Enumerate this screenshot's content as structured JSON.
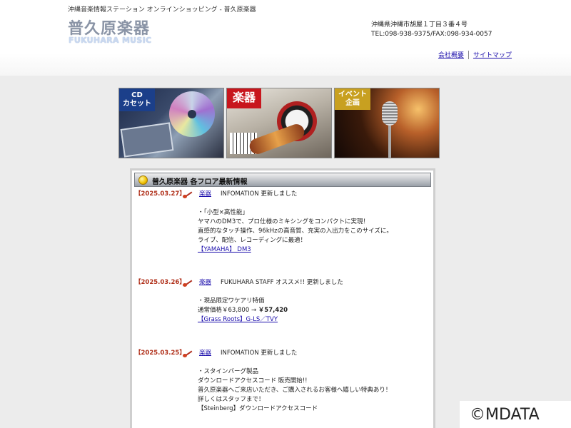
{
  "header": {
    "tagline": "沖縄音楽情報ステーション オンラインショッピング - 普久原楽器",
    "logo_jp": "普久原楽器",
    "logo_en": "FUKUHARA MUSIC",
    "address_line1": "沖縄県沖縄市胡屋１丁目３番４号",
    "address_line2": "TEL:098-938-9375/FAX:098-934-0057",
    "links": [
      {
        "label": "会社概要"
      },
      {
        "label": "サイトマップ"
      }
    ]
  },
  "banners": {
    "cd_label_1": "CD",
    "cd_label_2": "カセット",
    "instruments_label": "楽器",
    "event_label_1": "イベント",
    "event_label_2": "企画"
  },
  "section": {
    "title": "普久原楽器 各フロア最新情報"
  },
  "news": [
    {
      "date": "【2025.03.27】",
      "category": "楽器",
      "title": "INFOMATION 更新しました",
      "lines": [
        "・「小型×高性能」",
        "ヤマハのDM3で、プロ仕様のミキシングをコンパクトに実現！",
        "直感的なタッチ操作、96kHzの高音質、充実の入出力をこのサイズに。",
        "ライブ、配信、レコーディングに最適！"
      ],
      "link": "【YAMAHA】 DM3"
    },
    {
      "date": "【2025.03.26】",
      "category": "楽器",
      "title": "FUKUHARA STAFF オススメ!! 更新しました",
      "line1": "・現品限定ワケアリ特価",
      "price_normal": "通常価格￥63,800 → ",
      "price_sale": "￥57,420",
      "link": "【Grass Roots】G-LS／TVY"
    },
    {
      "date": "【2025.03.25】",
      "category": "楽器",
      "title": "INFOMATION 更新しました",
      "lines": [
        "・スタインバーグ製品",
        "ダウンロードアクセスコード 販売開始!!",
        "普久原楽器へご来店いただき、ご購入されるお客様へ嬉しい特典あり！",
        "詳しくはスタッフまで！",
        "【Steinberg】ダウンロードアクセスコード"
      ]
    }
  ],
  "copyright": "©MDATA"
}
